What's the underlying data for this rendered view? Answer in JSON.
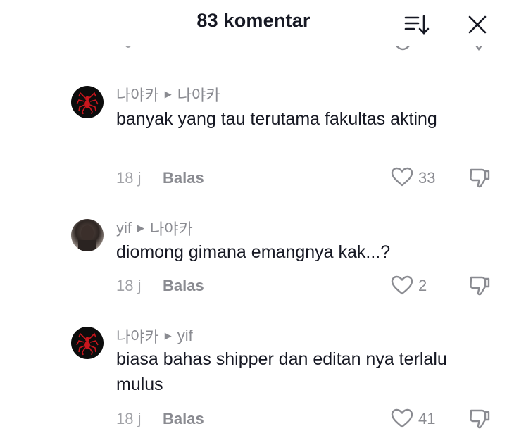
{
  "header": {
    "title": "83 komentar"
  },
  "comments": [
    {
      "author": "나야카",
      "reply_to": "나야카",
      "text": "banyak yang tau terutama fakultas akting",
      "time": "18 j",
      "reply_label": "Balas",
      "likes": "33"
    },
    {
      "author": "yif",
      "reply_to": "나야카",
      "text": "diomong gimana emangnya kak...?",
      "time": "18 j",
      "reply_label": "Balas",
      "likes": "2"
    },
    {
      "author": "나야카",
      "reply_to": "yif",
      "text": "biasa bahas shipper dan editan nya terlalu mulus",
      "time": "18 j",
      "reply_label": "Balas",
      "likes": "41"
    }
  ],
  "icons": {
    "sort": "sort-descending-icon",
    "close": "close-icon",
    "like": "heart-outline-icon",
    "dislike": "thumbs-down-icon",
    "reply_arrow": "triangle-right-icon"
  },
  "colors": {
    "text": "#161823",
    "muted": "#8a8b91",
    "background": "#ffffff"
  }
}
